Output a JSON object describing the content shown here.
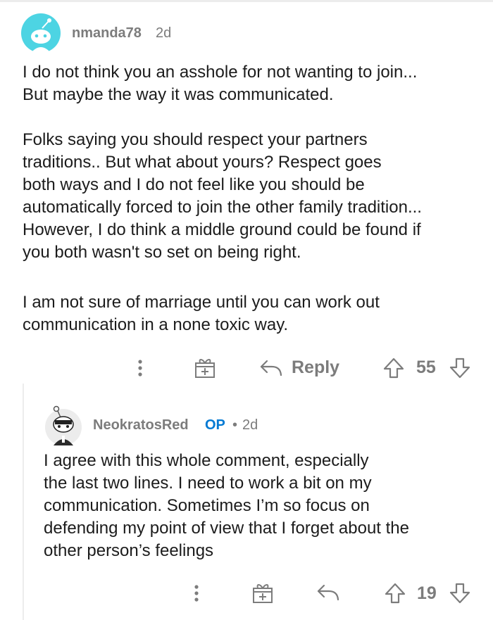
{
  "comments": [
    {
      "username": "nmanda78",
      "age": "2d",
      "paragraphs": [
        "I do not think you an asshole for not wanting to join...\nBut maybe the way it was communicated.",
        "Folks saying you should respect your partners\ntraditions.. But what about yours? Respect goes\nboth ways and I do not feel like you should be\nautomatically forced to join the other family tradition...\nHowever, I do think a middle ground could be found if\nyou both wasn't so set on being right.",
        "I am not sure of marriage until you can work out\ncommunication in a none toxic way."
      ],
      "actions": {
        "reply_label": "Reply",
        "vote_count": "55"
      }
    },
    {
      "username": "NeokratosRed",
      "op_badge": "OP",
      "separator": "•",
      "age": "2d",
      "paragraphs": [
        "I agree with this whole comment, especially\nthe last two lines. I need to work a bit on my\ncommunication. Sometimes I’m so focus on\ndefending my point of view that I forget about the\nother person’s feelings"
      ],
      "actions": {
        "vote_count": "19"
      }
    }
  ],
  "colors": {
    "meta_gray": "#7c7c7c",
    "op_blue": "#0079d3",
    "avatar_teal": "#4dd4e3"
  },
  "icons": [
    "more-vertical-icon",
    "gift-award-icon",
    "reply-arrow-icon",
    "upvote-icon",
    "downvote-icon"
  ]
}
